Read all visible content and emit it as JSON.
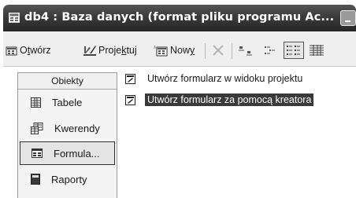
{
  "window": {
    "title": "db4 : Baza danych (format pliku programu Ac..."
  },
  "icons": {
    "app": "database-window-icon",
    "minimize": "minimize-icon"
  },
  "toolbar": {
    "open": {
      "pre": "O",
      "u": "t",
      "post": "wórz"
    },
    "design": {
      "pre": "Proje",
      "u": "k",
      "post": "tuj"
    },
    "new": {
      "pre": "Now",
      "u": "y",
      "post": ""
    }
  },
  "objects_pane": {
    "header": "Obiekty",
    "items": [
      {
        "label": "Tabele",
        "icon": "table-icon"
      },
      {
        "label": "Kwerendy",
        "icon": "query-icon"
      },
      {
        "label": "Formula...",
        "icon": "form-icon",
        "selected": true
      },
      {
        "label": "Raporty",
        "icon": "report-icon"
      }
    ]
  },
  "create_list": [
    {
      "label": "Utwórz formularz w widoku projektu",
      "icon": "create-form-design-icon"
    },
    {
      "label": "Utwórz formularz za pomocą kreatora",
      "icon": "create-form-wizard-icon",
      "selected": true
    }
  ]
}
